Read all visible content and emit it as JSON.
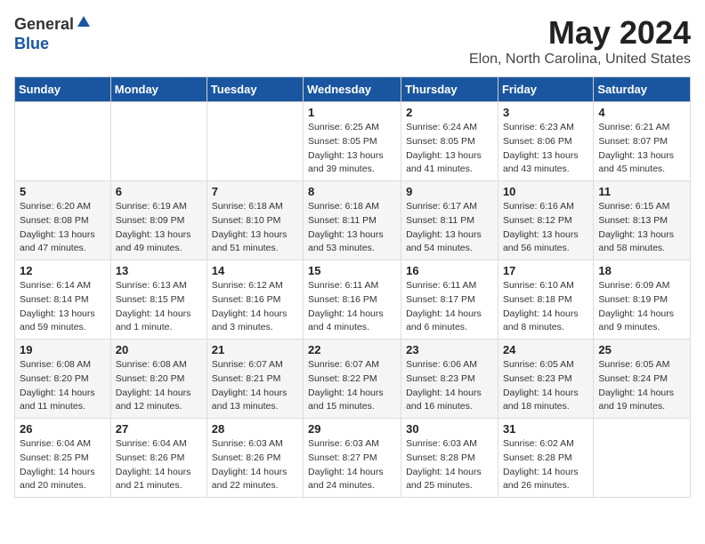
{
  "logo": {
    "general": "General",
    "blue": "Blue"
  },
  "title": {
    "month": "May 2024",
    "location": "Elon, North Carolina, United States"
  },
  "headers": [
    "Sunday",
    "Monday",
    "Tuesday",
    "Wednesday",
    "Thursday",
    "Friday",
    "Saturday"
  ],
  "weeks": [
    [
      {
        "day": "",
        "sunrise": "",
        "sunset": "",
        "daylight": ""
      },
      {
        "day": "",
        "sunrise": "",
        "sunset": "",
        "daylight": ""
      },
      {
        "day": "",
        "sunrise": "",
        "sunset": "",
        "daylight": ""
      },
      {
        "day": "1",
        "sunrise": "Sunrise: 6:25 AM",
        "sunset": "Sunset: 8:05 PM",
        "daylight": "Daylight: 13 hours and 39 minutes."
      },
      {
        "day": "2",
        "sunrise": "Sunrise: 6:24 AM",
        "sunset": "Sunset: 8:05 PM",
        "daylight": "Daylight: 13 hours and 41 minutes."
      },
      {
        "day": "3",
        "sunrise": "Sunrise: 6:23 AM",
        "sunset": "Sunset: 8:06 PM",
        "daylight": "Daylight: 13 hours and 43 minutes."
      },
      {
        "day": "4",
        "sunrise": "Sunrise: 6:21 AM",
        "sunset": "Sunset: 8:07 PM",
        "daylight": "Daylight: 13 hours and 45 minutes."
      }
    ],
    [
      {
        "day": "5",
        "sunrise": "Sunrise: 6:20 AM",
        "sunset": "Sunset: 8:08 PM",
        "daylight": "Daylight: 13 hours and 47 minutes."
      },
      {
        "day": "6",
        "sunrise": "Sunrise: 6:19 AM",
        "sunset": "Sunset: 8:09 PM",
        "daylight": "Daylight: 13 hours and 49 minutes."
      },
      {
        "day": "7",
        "sunrise": "Sunrise: 6:18 AM",
        "sunset": "Sunset: 8:10 PM",
        "daylight": "Daylight: 13 hours and 51 minutes."
      },
      {
        "day": "8",
        "sunrise": "Sunrise: 6:18 AM",
        "sunset": "Sunset: 8:11 PM",
        "daylight": "Daylight: 13 hours and 53 minutes."
      },
      {
        "day": "9",
        "sunrise": "Sunrise: 6:17 AM",
        "sunset": "Sunset: 8:11 PM",
        "daylight": "Daylight: 13 hours and 54 minutes."
      },
      {
        "day": "10",
        "sunrise": "Sunrise: 6:16 AM",
        "sunset": "Sunset: 8:12 PM",
        "daylight": "Daylight: 13 hours and 56 minutes."
      },
      {
        "day": "11",
        "sunrise": "Sunrise: 6:15 AM",
        "sunset": "Sunset: 8:13 PM",
        "daylight": "Daylight: 13 hours and 58 minutes."
      }
    ],
    [
      {
        "day": "12",
        "sunrise": "Sunrise: 6:14 AM",
        "sunset": "Sunset: 8:14 PM",
        "daylight": "Daylight: 13 hours and 59 minutes."
      },
      {
        "day": "13",
        "sunrise": "Sunrise: 6:13 AM",
        "sunset": "Sunset: 8:15 PM",
        "daylight": "Daylight: 14 hours and 1 minute."
      },
      {
        "day": "14",
        "sunrise": "Sunrise: 6:12 AM",
        "sunset": "Sunset: 8:16 PM",
        "daylight": "Daylight: 14 hours and 3 minutes."
      },
      {
        "day": "15",
        "sunrise": "Sunrise: 6:11 AM",
        "sunset": "Sunset: 8:16 PM",
        "daylight": "Daylight: 14 hours and 4 minutes."
      },
      {
        "day": "16",
        "sunrise": "Sunrise: 6:11 AM",
        "sunset": "Sunset: 8:17 PM",
        "daylight": "Daylight: 14 hours and 6 minutes."
      },
      {
        "day": "17",
        "sunrise": "Sunrise: 6:10 AM",
        "sunset": "Sunset: 8:18 PM",
        "daylight": "Daylight: 14 hours and 8 minutes."
      },
      {
        "day": "18",
        "sunrise": "Sunrise: 6:09 AM",
        "sunset": "Sunset: 8:19 PM",
        "daylight": "Daylight: 14 hours and 9 minutes."
      }
    ],
    [
      {
        "day": "19",
        "sunrise": "Sunrise: 6:08 AM",
        "sunset": "Sunset: 8:20 PM",
        "daylight": "Daylight: 14 hours and 11 minutes."
      },
      {
        "day": "20",
        "sunrise": "Sunrise: 6:08 AM",
        "sunset": "Sunset: 8:20 PM",
        "daylight": "Daylight: 14 hours and 12 minutes."
      },
      {
        "day": "21",
        "sunrise": "Sunrise: 6:07 AM",
        "sunset": "Sunset: 8:21 PM",
        "daylight": "Daylight: 14 hours and 13 minutes."
      },
      {
        "day": "22",
        "sunrise": "Sunrise: 6:07 AM",
        "sunset": "Sunset: 8:22 PM",
        "daylight": "Daylight: 14 hours and 15 minutes."
      },
      {
        "day": "23",
        "sunrise": "Sunrise: 6:06 AM",
        "sunset": "Sunset: 8:23 PM",
        "daylight": "Daylight: 14 hours and 16 minutes."
      },
      {
        "day": "24",
        "sunrise": "Sunrise: 6:05 AM",
        "sunset": "Sunset: 8:23 PM",
        "daylight": "Daylight: 14 hours and 18 minutes."
      },
      {
        "day": "25",
        "sunrise": "Sunrise: 6:05 AM",
        "sunset": "Sunset: 8:24 PM",
        "daylight": "Daylight: 14 hours and 19 minutes."
      }
    ],
    [
      {
        "day": "26",
        "sunrise": "Sunrise: 6:04 AM",
        "sunset": "Sunset: 8:25 PM",
        "daylight": "Daylight: 14 hours and 20 minutes."
      },
      {
        "day": "27",
        "sunrise": "Sunrise: 6:04 AM",
        "sunset": "Sunset: 8:26 PM",
        "daylight": "Daylight: 14 hours and 21 minutes."
      },
      {
        "day": "28",
        "sunrise": "Sunrise: 6:03 AM",
        "sunset": "Sunset: 8:26 PM",
        "daylight": "Daylight: 14 hours and 22 minutes."
      },
      {
        "day": "29",
        "sunrise": "Sunrise: 6:03 AM",
        "sunset": "Sunset: 8:27 PM",
        "daylight": "Daylight: 14 hours and 24 minutes."
      },
      {
        "day": "30",
        "sunrise": "Sunrise: 6:03 AM",
        "sunset": "Sunset: 8:28 PM",
        "daylight": "Daylight: 14 hours and 25 minutes."
      },
      {
        "day": "31",
        "sunrise": "Sunrise: 6:02 AM",
        "sunset": "Sunset: 8:28 PM",
        "daylight": "Daylight: 14 hours and 26 minutes."
      },
      {
        "day": "",
        "sunrise": "",
        "sunset": "",
        "daylight": ""
      }
    ]
  ]
}
